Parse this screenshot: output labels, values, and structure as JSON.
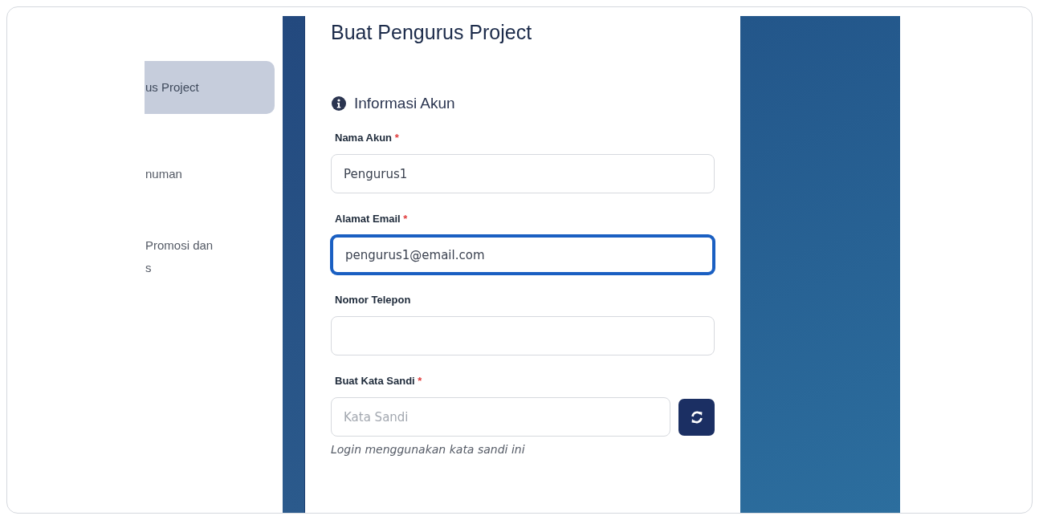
{
  "sidebar": {
    "items": [
      {
        "label": "us Project",
        "selected": true
      },
      {
        "label": "numan",
        "selected": false
      },
      {
        "label": "Promosi dan\ns",
        "selected": false
      }
    ]
  },
  "form": {
    "title": "Buat Pengurus Project",
    "section": "Informasi Akun",
    "fields": [
      {
        "kind": "text",
        "label": "Nama Akun",
        "required_mark": "*",
        "value": "Pengurus1",
        "focused": false
      },
      {
        "kind": "text",
        "label": "Alamat Email",
        "required_mark": "*",
        "value": "pengurus1@email.com",
        "focused": true
      },
      {
        "kind": "text",
        "label": "Nomor Telepon",
        "focused": false
      },
      {
        "kind": "password",
        "label": "Buat Kata Sandi",
        "required_mark": "*",
        "placeholder": "Kata Sandi",
        "focused": false,
        "hint": "Login menggunakan kata sandi ini"
      }
    ]
  }
}
